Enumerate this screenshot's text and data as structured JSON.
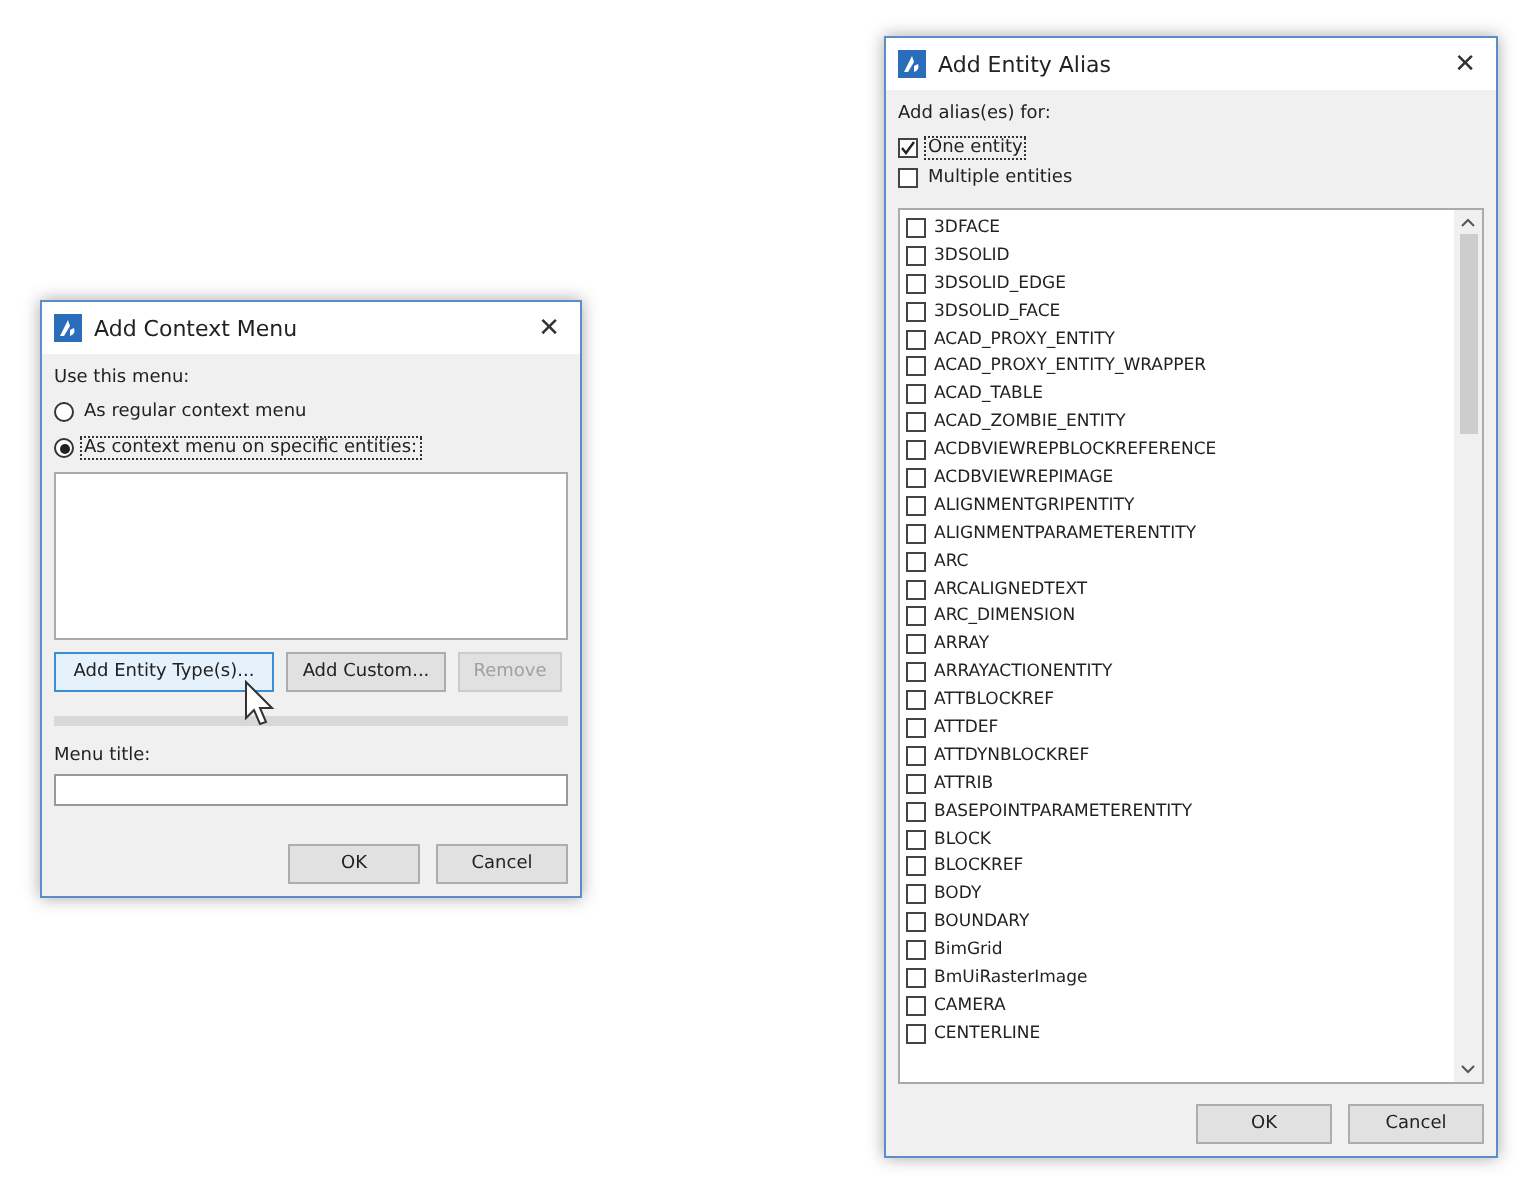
{
  "context_dialog": {
    "title": "Add Context Menu",
    "close": "✕",
    "prompt": "Use this menu:",
    "options": [
      {
        "label": "As regular context menu",
        "selected": false
      },
      {
        "label": "As context menu on specific entities:",
        "selected": true
      }
    ],
    "buttons": [
      {
        "label": "Add Entity Type(s)...",
        "disabled": false,
        "hovered": true
      },
      {
        "label": "Add Custom...",
        "disabled": false,
        "hovered": false
      },
      {
        "label": "Remove",
        "disabled": true,
        "hovered": false
      }
    ],
    "menu_title_label": "Menu title:",
    "ok": "OK",
    "cancel": "Cancel"
  },
  "alias_dialog": {
    "title": "Add Entity Alias",
    "close": "✕",
    "prompt": "Add alias(es) for:",
    "modes": [
      {
        "label": "One entity",
        "checked": true
      },
      {
        "label": "Multiple entities",
        "checked": false
      }
    ],
    "entities": [
      {
        "label": "3DFACE",
        "checked": false
      },
      {
        "label": "3DSOLID",
        "checked": false
      },
      {
        "label": "3DSOLID_EDGE",
        "checked": false
      },
      {
        "label": "3DSOLID_FACE",
        "checked": false
      },
      {
        "label": "ACAD_PROXY_ENTITY",
        "checked": false
      },
      {
        "label": "ACAD_PROXY_ENTITY_WRAPPER",
        "checked": false
      },
      {
        "label": "ACAD_TABLE",
        "checked": false
      },
      {
        "label": "ACAD_ZOMBIE_ENTITY",
        "checked": false
      },
      {
        "label": "ACDBVIEWREPBLOCKREFERENCE",
        "checked": false
      },
      {
        "label": "ACDBVIEWREPIMAGE",
        "checked": false
      },
      {
        "label": "ALIGNMENTGRIPENTITY",
        "checked": false
      },
      {
        "label": "ALIGNMENTPARAMETERENTITY",
        "checked": false
      },
      {
        "label": "ARC",
        "checked": false
      },
      {
        "label": "ARCALIGNEDTEXT",
        "checked": false
      },
      {
        "label": "ARC_DIMENSION",
        "checked": false
      },
      {
        "label": "ARRAY",
        "checked": false
      },
      {
        "label": "ARRAYACTIONENTITY",
        "checked": false
      },
      {
        "label": "ATTBLOCKREF",
        "checked": false
      },
      {
        "label": "ATTDEF",
        "checked": false
      },
      {
        "label": "ATTDYNBLOCKREF",
        "checked": false
      },
      {
        "label": "ATTRIB",
        "checked": false
      },
      {
        "label": "BASEPOINTPARAMETERENTITY",
        "checked": false
      },
      {
        "label": "BLOCK",
        "checked": false
      },
      {
        "label": "BLOCKREF",
        "checked": false
      },
      {
        "label": "BODY",
        "checked": false
      },
      {
        "label": "BOUNDARY",
        "checked": false
      },
      {
        "label": "BimGrid",
        "checked": false
      },
      {
        "label": "BmUiRasterImage",
        "checked": false
      },
      {
        "label": "CAMERA",
        "checked": false
      },
      {
        "label": "CENTERLINE",
        "checked": false
      }
    ],
    "ok": "OK",
    "cancel": "Cancel"
  }
}
